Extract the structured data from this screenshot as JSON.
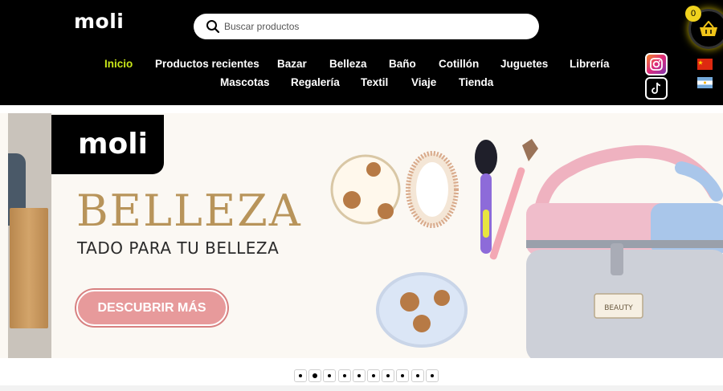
{
  "brand": {
    "logo_text": "moli"
  },
  "search": {
    "placeholder": "Buscar productos",
    "icon": "search-icon"
  },
  "cart": {
    "count": "0",
    "icon": "basket-icon"
  },
  "nav": {
    "row1": [
      "Inicio",
      "Productos recientes",
      "Bazar",
      "Belleza",
      "Baño",
      "Cotillón",
      "Juguetes",
      "Librería"
    ],
    "row2": [
      "Mascotas",
      "Regalería",
      "Textil",
      "Viaje",
      "Tienda"
    ],
    "active": "Inicio",
    "active_color": "#c8e619"
  },
  "social": {
    "instagram_icon": "instagram-icon",
    "tiktok_icon": "tiktok-icon"
  },
  "languages": {
    "flags": [
      "china-flag-icon",
      "argentina-flag-icon"
    ]
  },
  "banner": {
    "logo_text": "moli",
    "headline": "BELLEZA",
    "subheadline": "TADO PARA TU BELLEZA",
    "cta_label": "DESCUBRIR MÁS",
    "accent_color": "#b8945a",
    "cta_color": "#e79a9b",
    "product_label": "BEAUTY"
  },
  "carousel": {
    "slide_count": 10,
    "active_index": 1
  }
}
